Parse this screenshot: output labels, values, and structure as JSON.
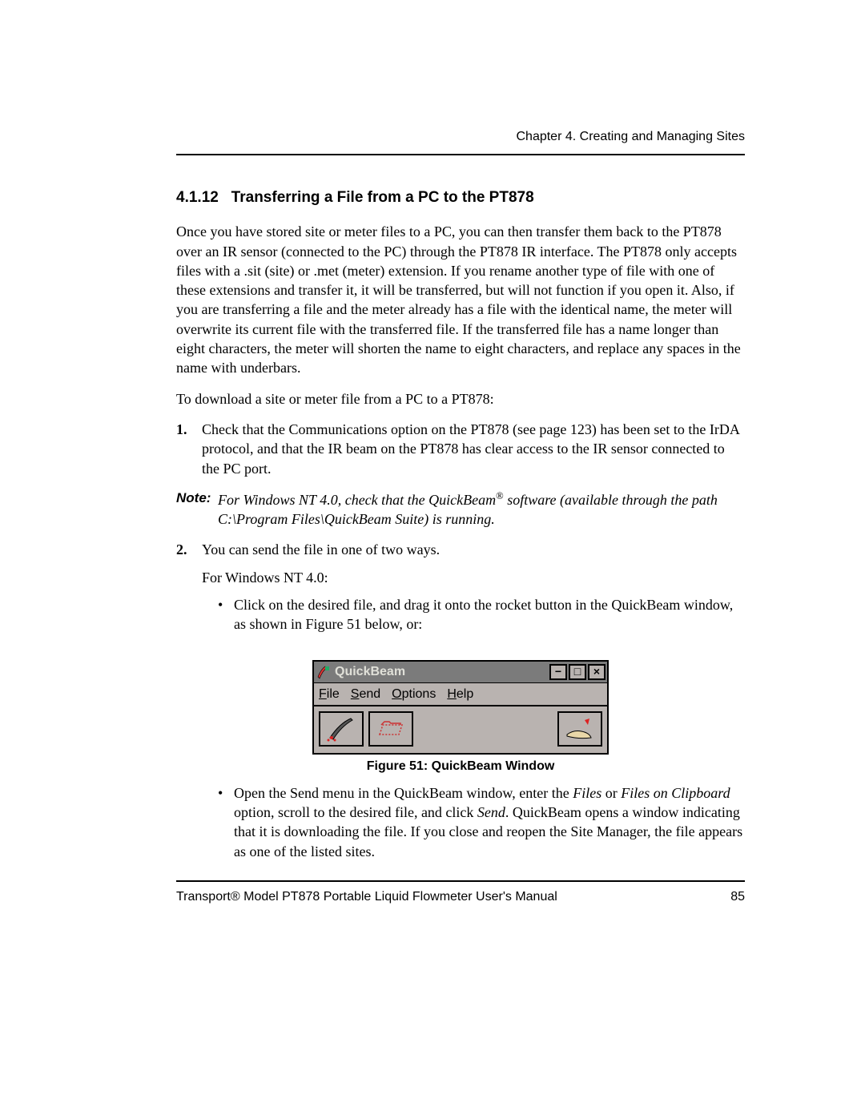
{
  "running_head": "Chapter 4. Creating and Managing Sites",
  "heading": {
    "number": "4.1.12",
    "title": "Transferring a File from a PC to the PT878"
  },
  "p1": "Once you have stored site or meter files to a PC, you can then transfer them back to the PT878 over an IR sensor (connected to the PC) through the PT878 IR interface. The PT878 only accepts files with a .sit (site) or .met (meter) extension. If you rename another type of file with one of these extensions and transfer it, it will be transferred, but will not function if you open it. Also, if you are transferring a file and the meter already has a file with the identical name, the meter will overwrite its current file with the transferred file. If the transferred file has a name longer than eight characters, the meter will shorten the name to eight characters, and replace any spaces in the name with underbars.",
  "p2": "To download a site or meter file from a PC to a PT878:",
  "steps": {
    "s1_num": "1.",
    "s1_text": "Check that the Communications option on the PT878 (see page 123) has been set to the IrDA protocol, and that the IR beam on the PT878 has clear access to the IR sensor connected to the PC port.",
    "s2_num": "2.",
    "s2_text": "You can send the file in one of two ways.",
    "s2_sub": "For Windows NT 4.0:",
    "s2_b1": "Click on the desired file, and drag it onto the rocket button in the QuickBeam window, as shown in Figure 51 below, or:",
    "s2_b2_pre": "Open the Send menu in the QuickBeam window, enter the ",
    "s2_b2_i1": "Files",
    "s2_b2_mid1": " or ",
    "s2_b2_i2": "Files on Clipboard",
    "s2_b2_mid2": " option, scroll to the desired file, and click ",
    "s2_b2_i3": "Send",
    "s2_b2_post": ". QuickBeam opens a window indicating that it is downloading the file. If you close and reopen the Site Manager, the file appears as one of the listed sites."
  },
  "note": {
    "label": "Note:",
    "pre": "For Windows NT 4.0, check that the QuickBeam",
    "reg": "®",
    "post": " software (available through the path C:\\Program Files\\QuickBeam Suite) is running."
  },
  "figure": {
    "title": "QuickBeam",
    "menu": {
      "file": "File",
      "send": "Send",
      "options": "Options",
      "help": "Help"
    },
    "caption": "Figure 51: QuickBeam Window"
  },
  "footer": {
    "left": "Transport® Model PT878 Portable Liquid Flowmeter User's Manual",
    "right": "85"
  },
  "icons": {
    "minimize": "−",
    "maximize": "□",
    "close": "×"
  }
}
